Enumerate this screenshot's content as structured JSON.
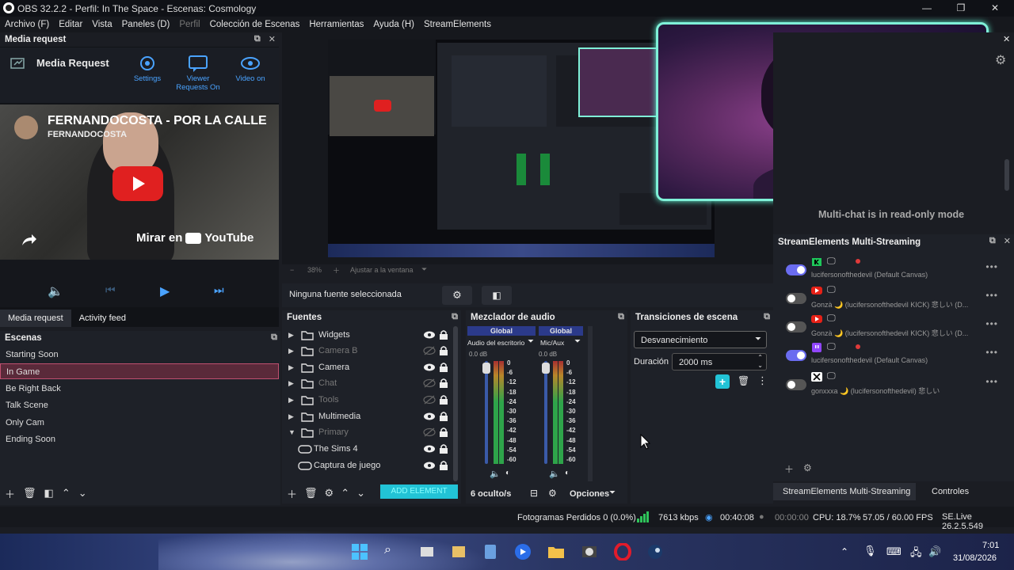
{
  "window": {
    "title": "OBS 32.2.2 - Perfil: In The Space - Escenas: Cosmology"
  },
  "menu": [
    "Archivo (F)",
    "Editar",
    "Vista",
    "Paneles (D)",
    "Perfil",
    "Colección de Escenas",
    "Herramientas",
    "Ayuda (H)",
    "StreamElements"
  ],
  "media_request": {
    "dock_title": "Media request",
    "app_title": "Media Request",
    "settings": "Settings",
    "viewer": "Viewer Requests On",
    "video_on": "Video on",
    "video_title": "FERNANDOCOSTA - POR LA CALLE",
    "channel": "FERNANDOCOSTA",
    "watch_on": "Mirar en",
    "youtube": "YouTube",
    "tabs": [
      "Media request",
      "Activity feed"
    ]
  },
  "scenes": {
    "title": "Escenas",
    "items": [
      "Starting Soon",
      "In Game",
      "Be Right Back",
      "Talk Scene",
      "Only Cam",
      "Ending Soon"
    ],
    "selected_index": 1
  },
  "preview": {
    "zoom": "38%",
    "fit": "Ajustar a la ventana",
    "no_source": "Ninguna fuente seleccionada"
  },
  "sources": {
    "title": "Fuentes",
    "items": [
      {
        "label": "Widgets",
        "type": "folder",
        "visible": true
      },
      {
        "label": "Camera B",
        "type": "folder",
        "visible": false
      },
      {
        "label": "Camera",
        "type": "folder",
        "visible": true
      },
      {
        "label": "Chat",
        "type": "folder",
        "visible": false
      },
      {
        "label": "Tools",
        "type": "folder",
        "visible": false
      },
      {
        "label": "Multimedia",
        "type": "folder",
        "visible": true
      },
      {
        "label": "Primary",
        "type": "folder-open",
        "visible": false
      },
      {
        "label": "The Sims 4",
        "type": "game",
        "visible": true
      },
      {
        "label": "Captura de juego",
        "type": "game",
        "visible": true
      }
    ],
    "add_element": "ADD ELEMENT"
  },
  "mixer": {
    "title": "Mezclador de audio",
    "channels": [
      {
        "group": "Global",
        "name": "Audio del escritorio",
        "db": "0.0 dB"
      },
      {
        "group": "Global",
        "name": "Mic/Aux",
        "db": "0.0 dB"
      }
    ],
    "scale": [
      "0",
      "-6",
      "-12",
      "-18",
      "-24",
      "-30",
      "-36",
      "-42",
      "-48",
      "-54",
      "-60"
    ],
    "hidden": "6 oculto/s",
    "options": "Opciones"
  },
  "transitions": {
    "title": "Transiciones de escena",
    "selected": "Desvanecimiento",
    "duration_label": "Duración",
    "duration_value": "2000 ms"
  },
  "chat": {
    "readonly": "Multi-chat is in read-only mode"
  },
  "multistream": {
    "title": "StreamElements Multi-Streaming",
    "rows": [
      {
        "platform": "kick",
        "on": true,
        "sub": "lucifersonofthedevil (Default Canvas)",
        "live": true
      },
      {
        "platform": "youtube",
        "on": false,
        "sub": "Gonzà 🌙 (lucifersonofthedevil KICK) 悲しい (D...",
        "live": false
      },
      {
        "platform": "youtube",
        "on": false,
        "sub": "Gonzà 🌙 (lucifersonofthedevil KICK) 悲しい (D...",
        "live": false
      },
      {
        "platform": "twitch",
        "on": true,
        "sub": "lucifersonofthedevil (Default Canvas)",
        "live": true
      },
      {
        "platform": "x",
        "on": false,
        "sub": "gonxxxa 🌙 (lucifersonofthedevil) 悲しい",
        "live": false
      }
    ],
    "tabs": [
      "StreamElements Multi-Streaming",
      "Controles"
    ]
  },
  "status": {
    "dropped": "Fotogramas Perdidos 0 (0.0%)",
    "kbps": "7613 kbps",
    "live_time": "00:40:08",
    "rec_time": "00:00:00",
    "cpu": "CPU: 18.7%",
    "fps": "57.05 / 60.00 FPS",
    "version": "SE.Live 26.2.5.549"
  },
  "taskbar": {
    "time": "7:01",
    "date": "31/08/2026"
  },
  "colors": {
    "accent": "#4aa3ff",
    "cam_border": "#7ff0d8",
    "add_element": "#22c3d6"
  }
}
